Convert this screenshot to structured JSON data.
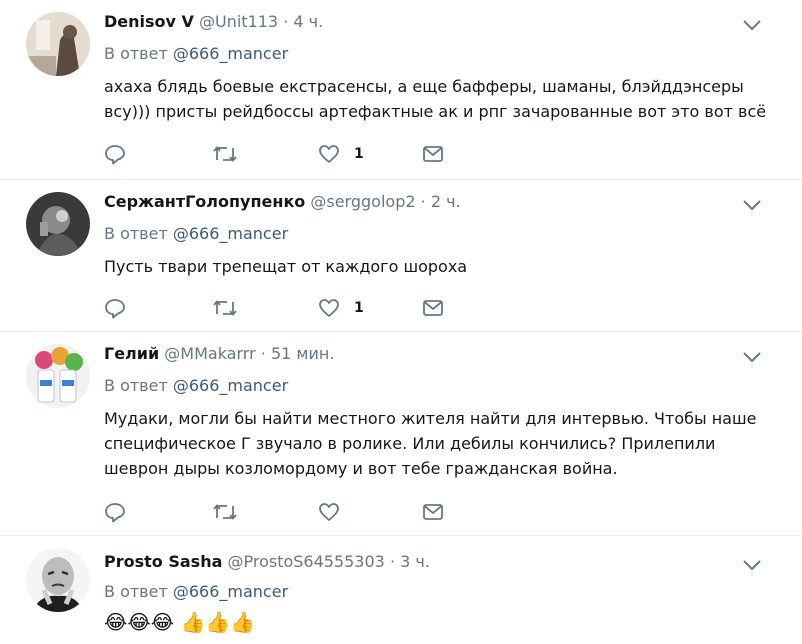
{
  "tweets": [
    {
      "name": "Denisov V",
      "handle": "@Unit113",
      "time": "4 ч.",
      "reply_prefix": "В ответ",
      "reply_mention": "@666_mancer",
      "text_lines": [
        "ахаха блядь боевые екстрасенсы, а еще бафферы, шаманы, блэйддэнсеры",
        "всу))) присты рейдбоссы артефактные ак и рпг зачарованные вот это вот всё"
      ],
      "like_count": "1"
    },
    {
      "name": "СержантГолопупенко",
      "handle": "@serggolop2",
      "time": "2 ч.",
      "reply_prefix": "В ответ",
      "reply_mention": "@666_mancer",
      "text_lines": [
        "Пусть твари трепещат от каждого шороха"
      ],
      "like_count": "1"
    },
    {
      "name": "Гелий",
      "handle": "@MMakarrr",
      "time": "51 мин.",
      "reply_prefix": "В ответ",
      "reply_mention": "@666_mancer",
      "text_lines": [
        "Мудаки, могли бы найти местного жителя найти для интервью. Чтобы наше",
        "специфическое Г звучало в ролике.  Или дебилы кончились? Прилепили",
        "шеврон дыры козломордому и вот тебе гражданская война."
      ],
      "like_count": ""
    },
    {
      "name": "Prosto Sasha",
      "handle": "@ProstoS64555303",
      "time": "3 ч.",
      "reply_prefix": "В ответ",
      "reply_mention": "@666_mancer",
      "text_lines": [
        "😂😂😂 👍👍👍"
      ],
      "like_count": ""
    }
  ],
  "separator": "·",
  "colors": {
    "text": "#14171a",
    "muted": "#657786",
    "mention": "#3c5a77",
    "divider": "#e6ecf0"
  },
  "icons": [
    "reply-icon",
    "retweet-icon",
    "like-icon",
    "dm-icon",
    "chevron-down-icon"
  ]
}
